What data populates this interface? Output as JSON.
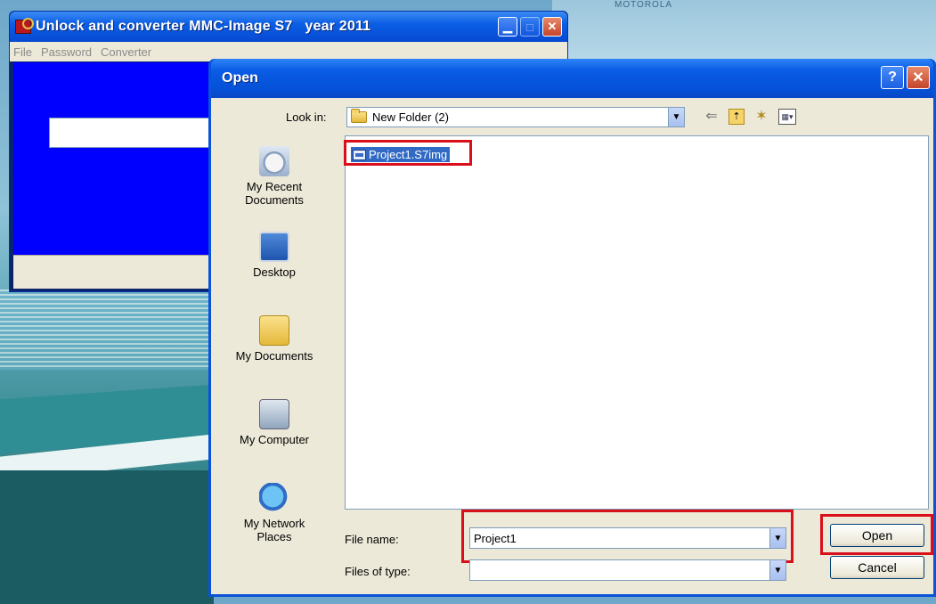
{
  "desktop": {
    "top_text": "MOTOROLA"
  },
  "app_window": {
    "title": "Unlock and converter MMC-Image S7   year 2011",
    "menu": [
      "File",
      "Password",
      "Converter"
    ],
    "textbox_value": ""
  },
  "dialog": {
    "title": "Open",
    "title_buttons": {
      "help": "?",
      "close": "✕"
    },
    "look_in": {
      "label": "Look in:",
      "value": "New Folder (2)"
    },
    "places": [
      {
        "label": "My Recent Documents",
        "icon": "recent-documents-icon"
      },
      {
        "label": "Desktop",
        "icon": "desktop-icon"
      },
      {
        "label": "My Documents",
        "icon": "my-documents-icon"
      },
      {
        "label": "My Computer",
        "icon": "my-computer-icon"
      },
      {
        "label": "My Network Places",
        "icon": "network-places-icon"
      }
    ],
    "files": [
      {
        "name": "Project1.S7img",
        "selected": true
      }
    ],
    "file_name": {
      "label": "File name:",
      "value": "Project1"
    },
    "files_of_type": {
      "label": "Files of type:",
      "value": ""
    },
    "buttons": {
      "open": "Open",
      "cancel": "Cancel"
    }
  },
  "colors": {
    "highlight": "#d90f1a",
    "selection": "#316ac5",
    "title_blue": "#0a5ce6"
  }
}
